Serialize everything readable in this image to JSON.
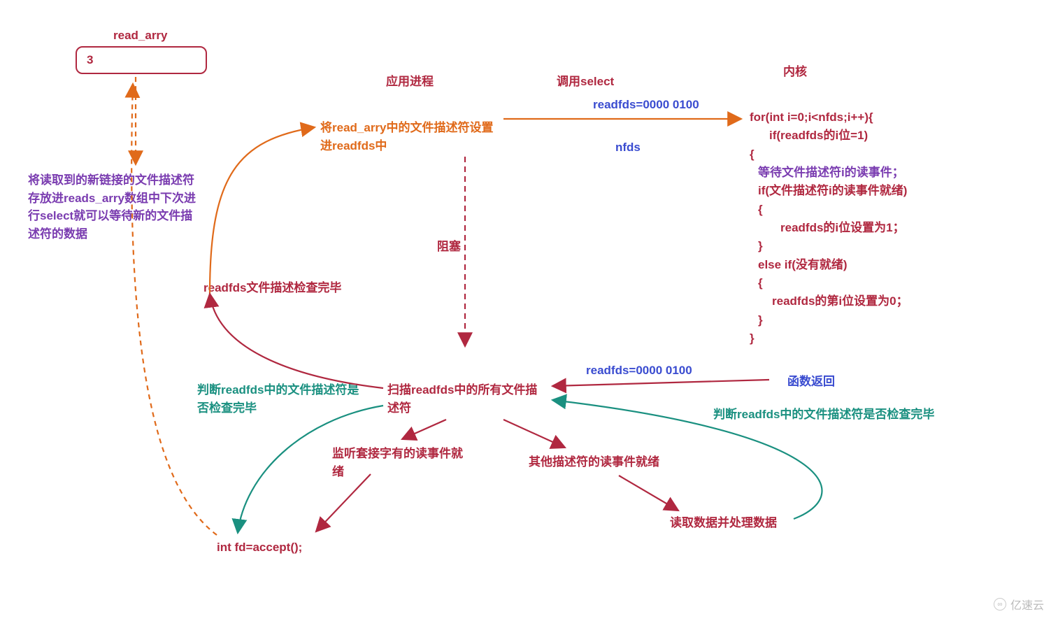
{
  "readArray": {
    "title": "read_arry",
    "value": "3"
  },
  "headings": {
    "appProcess": "应用进程",
    "callSelect": "调用select",
    "kernel": "内核"
  },
  "labelsBlue": {
    "readfds1": "readfds=0000 0100",
    "nfds": "nfds",
    "readfds2": "readfds=0000 0100",
    "funcReturn": "函数返回"
  },
  "stepSetReadfds": "将read_arry中的文件描述符设置进readfds中",
  "storeNewFd": "将读取到的新链接的文件描述符存放进reads_arry数组中下次进行select就可以等待新的文件描述符的数据",
  "block": "阻塞",
  "readfdsDone": "readfds文件描述检查完毕",
  "checkDoneLeft": "判断readfds中的文件描述符是否检查完毕",
  "checkDoneRight": "判断readfds中的文件描述符是否检查完毕",
  "scanAll": "扫描readfds中的所有文件描述符",
  "listenReady": "监听套接字有的读事件就绪",
  "otherReady": "其他描述符的读事件就绪",
  "readProcess": "读取数据并处理数据",
  "acceptCode": "int fd=accept();",
  "kernelCode": {
    "l1": "for(int i=0;i<nfds;i++){",
    "l2": "if(readfds的i位=1)",
    "l2b": "{",
    "l3": "等待文件描述符i的读事件；",
    "l4": "if(文件描述符i的读事件就绪)",
    "l4b": "{",
    "l5": "readfds的i位设置为1；",
    "l5b": "}",
    "l6": "else if(没有就绪)",
    "l6b": "{",
    "l7": "readfds的第i位设置为0；",
    "l7b": "}",
    "l8": "}"
  },
  "watermark": "亿速云"
}
